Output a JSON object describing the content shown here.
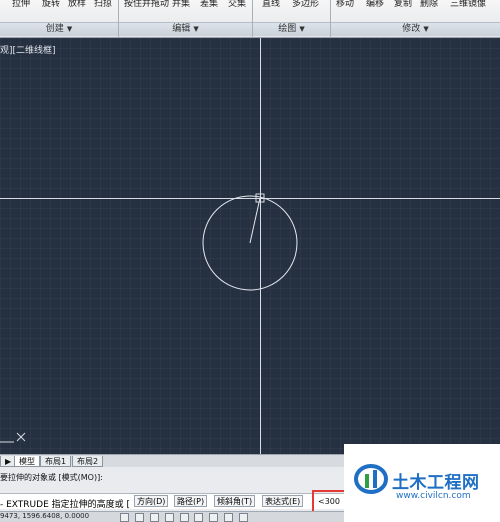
{
  "ribbon": {
    "items": [
      "拉伸",
      "旋转",
      "放样",
      "扫掠",
      "按住并拖动",
      "并集",
      "差集",
      "交集",
      "直线",
      "多边形",
      "移动",
      "编移",
      "复制",
      "删除",
      "三维镜像"
    ],
    "groups": [
      "创建",
      "编辑",
      "绘图",
      "修改"
    ]
  },
  "viewport": {
    "label": "观][二维线框]"
  },
  "tabs": [
    "模型",
    "布局1",
    "布局2"
  ],
  "command": {
    "line1": "要拉伸的对象或 [模式(MO)]:",
    "prefix": "- EXTRUDE 指定拉伸的高度或 [",
    "options": [
      "方向(D)",
      "路径(P)",
      "倾斜角(T)",
      "表达式(E)"
    ],
    "suffix": "]",
    "input_value": "<300"
  },
  "status": {
    "coords": "9473, 1596.6408, 0.0000"
  },
  "watermark": {
    "brand": "土木工程网",
    "url": "www.civilcn.com"
  },
  "colors": {
    "canvas": "#253041",
    "crosshair": "#d8dde4",
    "highlight": "#e53935",
    "brand": "#1f6fc4"
  }
}
